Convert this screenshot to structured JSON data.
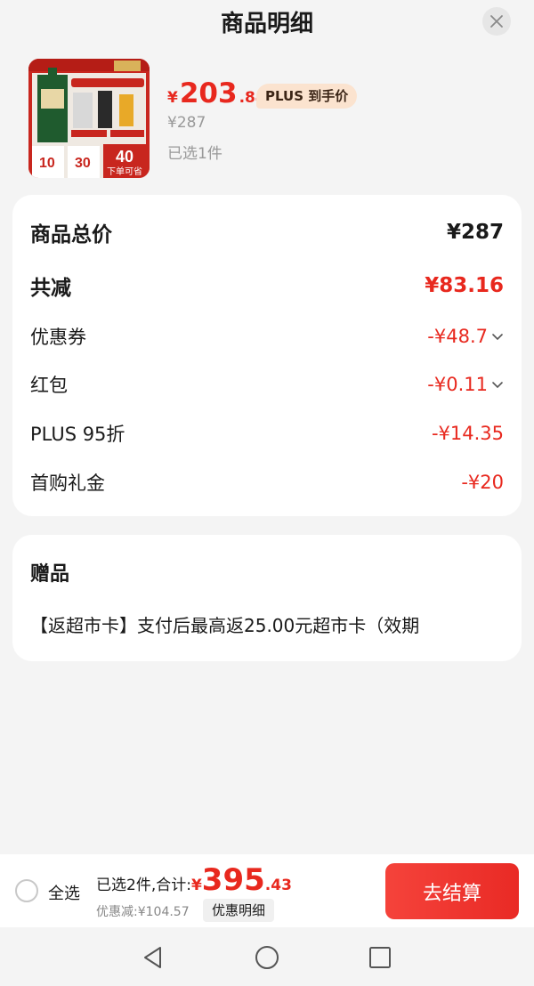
{
  "sheet": {
    "title": "商品明细",
    "close_icon": "close-icon"
  },
  "product": {
    "thumb_text": {
      "tag1": "10",
      "tag2": "30",
      "tag3": "40",
      "banner": "下单可省"
    },
    "price_symbol": "¥",
    "price_int": "203",
    "price_dec": ".84",
    "plus_badge": "PLUS 到手价",
    "orig_price": "¥287",
    "selected": "已选1件"
  },
  "price_detail": {
    "rows": [
      {
        "label": "商品总价",
        "value": "¥287"
      },
      {
        "label": "共减",
        "value": "¥83.16"
      },
      {
        "label": "优惠券",
        "value": "-¥48.7"
      },
      {
        "label": "红包",
        "value": "-¥0.11"
      },
      {
        "label": "PLUS 95折",
        "value": "-¥14.35"
      },
      {
        "label": "首购礼金",
        "value": "-¥20"
      }
    ]
  },
  "gift": {
    "title": "赠品",
    "text": "【返超市卡】支付后最高返25.00元超市卡（效期"
  },
  "bottom": {
    "select_all": "全选",
    "summary_label": "已选2件,合计:",
    "total_symbol": "¥",
    "total_int": "395",
    "total_dec": ".43",
    "discount": "优惠减:¥104.57",
    "detail_button": "优惠明细",
    "checkout_button": "去结算"
  },
  "colors": {
    "accent": "#e8281e",
    "plus_badge_bg": "#fbe3cf",
    "background": "#f4f4f4"
  }
}
